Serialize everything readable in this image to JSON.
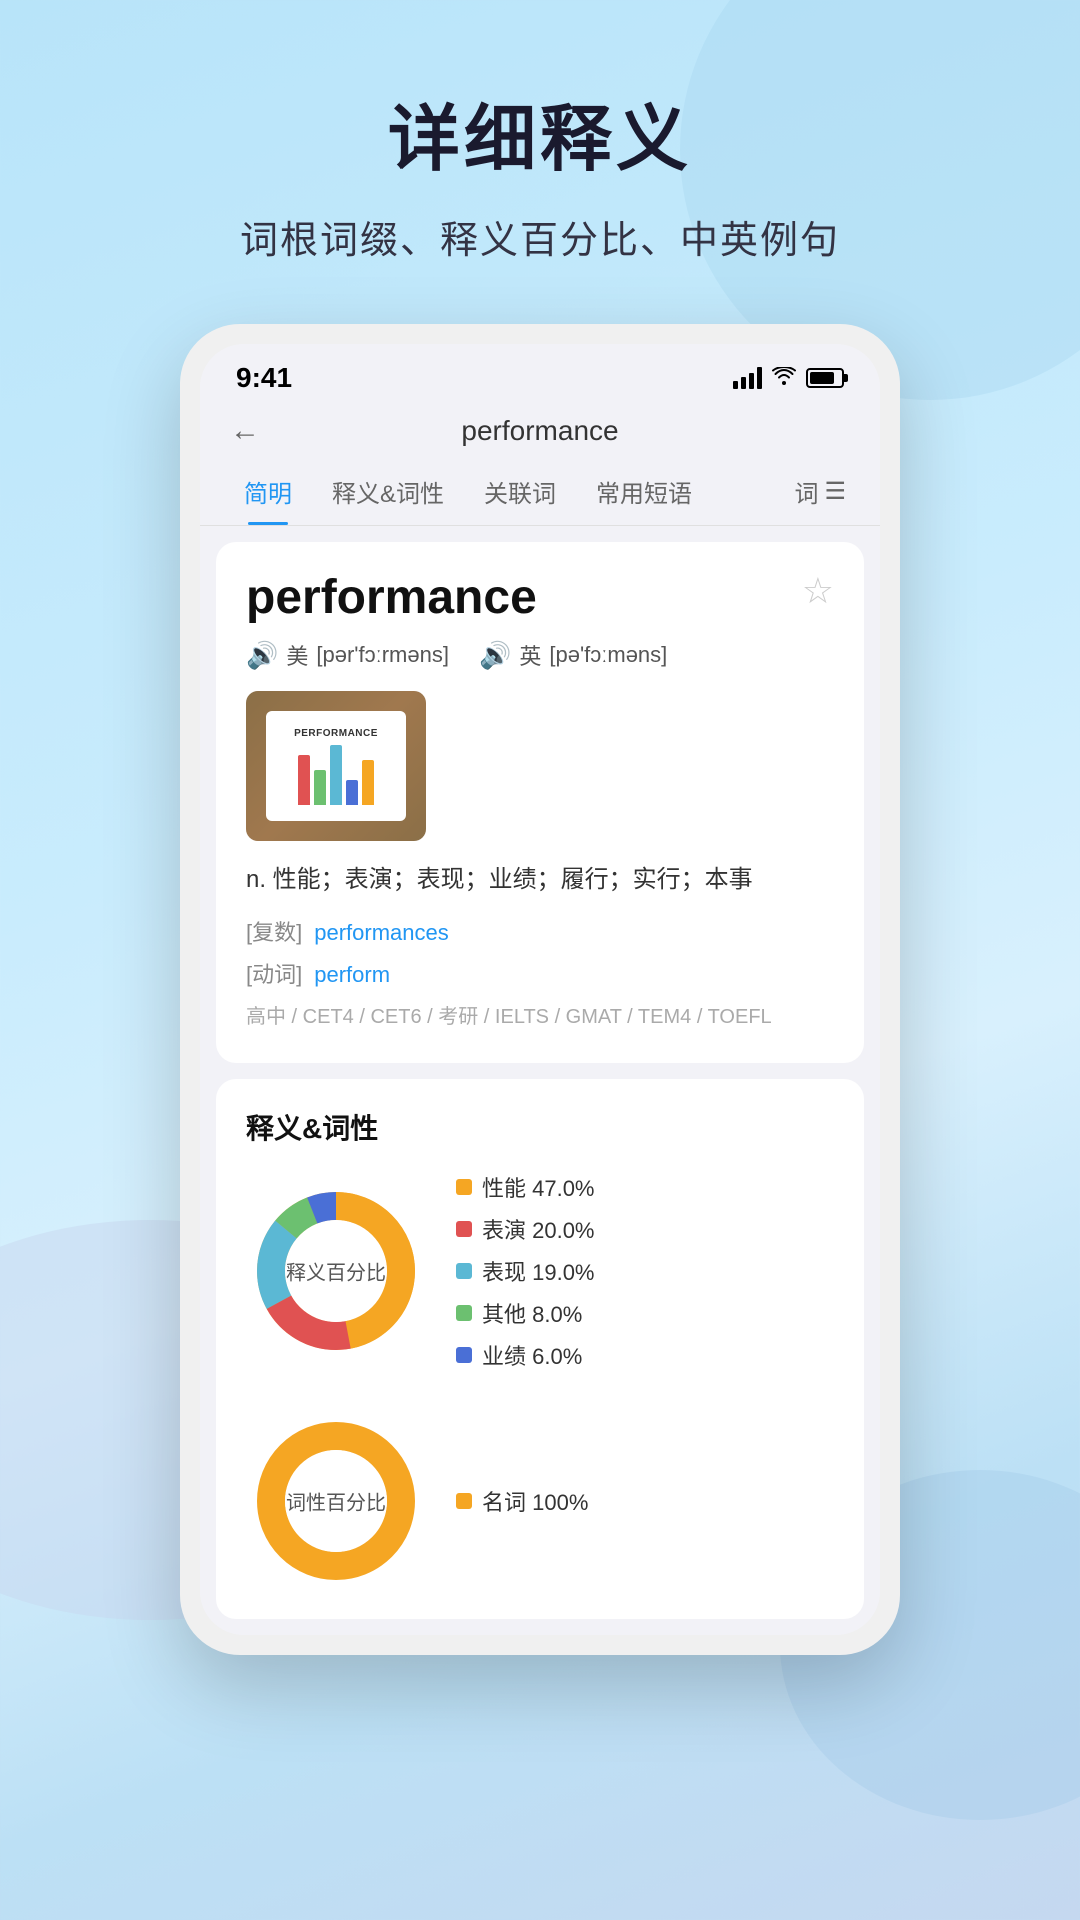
{
  "background": {
    "gradient_start": "#b8e4f9",
    "gradient_end": "#c5d8f0"
  },
  "page": {
    "main_title": "详细释义",
    "sub_title": "词根词缀、释义百分比、中英例句"
  },
  "status_bar": {
    "time": "9:41",
    "signal_label": "signal",
    "wifi_label": "wifi",
    "battery_label": "battery"
  },
  "app_header": {
    "back_icon": "←",
    "title": "performance"
  },
  "tabs": [
    {
      "id": "brief",
      "label": "简明",
      "active": true
    },
    {
      "id": "definition",
      "label": "释义&词性",
      "active": false
    },
    {
      "id": "related",
      "label": "关联词",
      "active": false
    },
    {
      "id": "phrases",
      "label": "常用短语",
      "active": false
    },
    {
      "id": "words",
      "label": "词",
      "active": false
    }
  ],
  "word_card": {
    "word": "performance",
    "star_icon": "☆",
    "pronunciations": [
      {
        "region": "美",
        "phonetic": "[pər'fɔːrməns]"
      },
      {
        "region": "英",
        "phonetic": "[pə'fɔːməns]"
      }
    ],
    "image_alt": "performance chart image",
    "image_label": "PERFORMANCE",
    "definition": "n. 性能；表演；表现；业绩；履行；实行；本事",
    "plural_label": "[复数]",
    "plural_link": "performances",
    "verb_label": "[动词]",
    "verb_link": "perform",
    "exam_tags": "高中 / CET4 / CET6 / 考研 / IELTS / GMAT / TEM4 / TOEFL"
  },
  "definition_card": {
    "title": "释义&词性",
    "donut1": {
      "label": "释义百分比",
      "segments": [
        {
          "label": "性能",
          "percent": 47.0,
          "color": "#F5A623"
        },
        {
          "label": "表演",
          "percent": 20.0,
          "color": "#E05252"
        },
        {
          "label": "表现",
          "percent": 19.0,
          "color": "#5BB8D4"
        },
        {
          "label": "其他",
          "percent": 8.0,
          "color": "#6CC070"
        },
        {
          "label": "业绩",
          "percent": 6.0,
          "color": "#4A6FD6"
        }
      ]
    },
    "donut2": {
      "label": "词性百分比",
      "segments": [
        {
          "label": "名词",
          "percent": 100,
          "color": "#F5A623"
        }
      ]
    }
  },
  "bar_chart_colors": [
    "#E05252",
    "#6CC070",
    "#5BB8D4",
    "#4A6FD6",
    "#F5A623"
  ],
  "bar_chart_heights": [
    50,
    35,
    60,
    25,
    45
  ]
}
